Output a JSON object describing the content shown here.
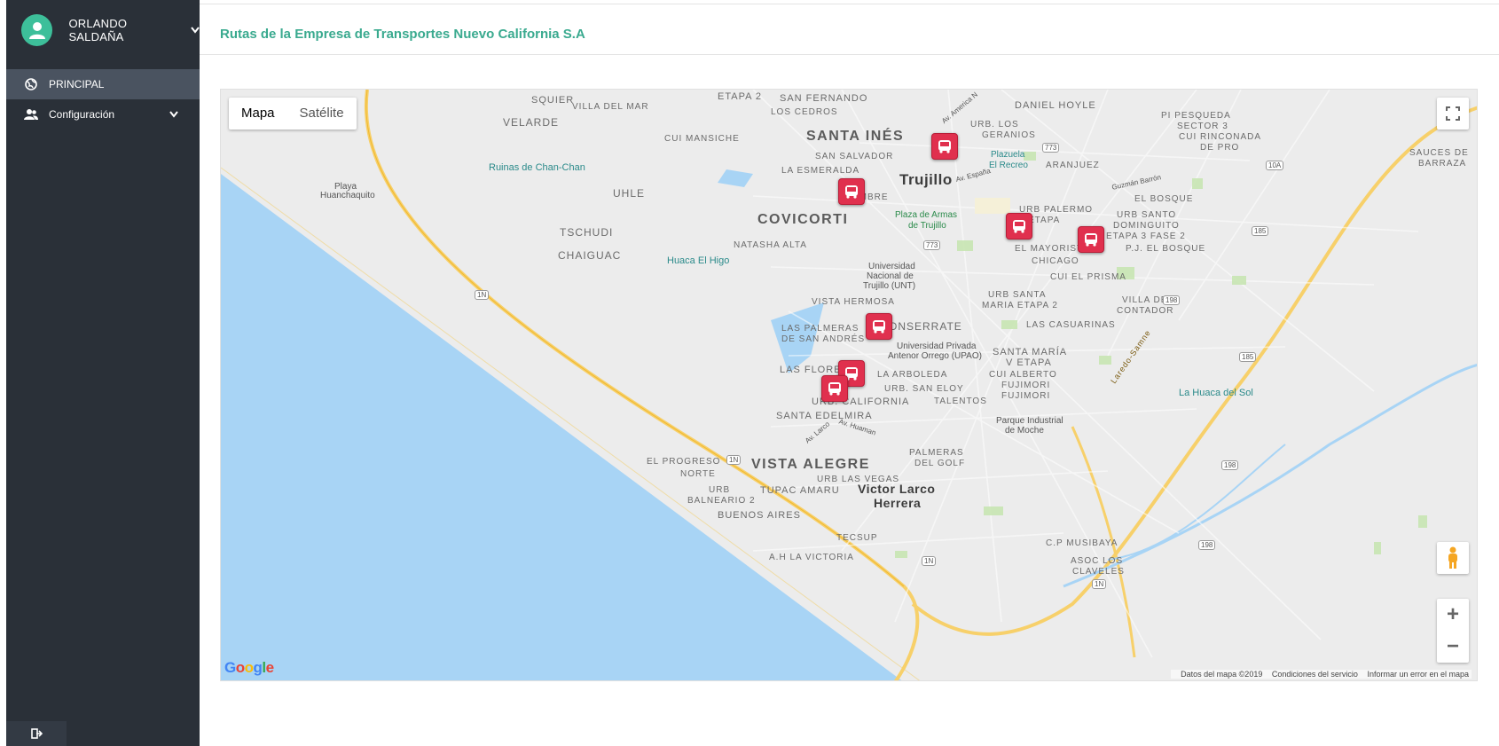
{
  "user": {
    "name": "ORLANDO SALDAÑA"
  },
  "sidebar": {
    "items": [
      {
        "label": "PRINCIPAL",
        "icon": "globe-icon",
        "active": true
      },
      {
        "label": "Configuración",
        "icon": "users-icon",
        "expandable": true
      }
    ]
  },
  "page": {
    "title": "Rutas de la Empresa de Transportes Nuevo California S.A"
  },
  "map": {
    "type_buttons": [
      "Mapa",
      "Satélite"
    ],
    "selected_type": "Mapa",
    "attribution": "Google",
    "footer": [
      "Datos del mapa ©2019",
      "Condiciones del servicio",
      "Informar un error en el mapa"
    ],
    "zoom_in": "+",
    "zoom_out": "−",
    "labels": {
      "squier": "SQUIER",
      "etapa2": "ETAPA 2",
      "san_fernando": "SAN FERNANDO",
      "daniel_hoyle": "DANIEL HOYLE",
      "villa_del_mar": "VILLA DEL MAR",
      "los_cedros": "LOS CEDROS",
      "velarde": "VELARDE",
      "pi_pesqueda": "PI PESQUEDA",
      "sector3": "SECTOR 3",
      "urb_los": "URB. LOS",
      "geranios": "GERANIOS",
      "santa_ines": "SANTA INÉS",
      "cui_mansiche": "CUI MANSICHE",
      "cui_rinconada": "CUI RINCONADA",
      "de_pro": "DE PRO",
      "sauces": "SAUCES DE",
      "barraza": "BARRAZA",
      "plazuela": "Plazuela",
      "el_recreo": "El Recreo",
      "aranjuez": "ARANJUEZ",
      "san_salvador": "SAN SALVADOR",
      "ruinas": "Ruinas de Chan-Chan",
      "la_esmeralda": "LA ESMERALDA",
      "trujillo": "Trujillo",
      "playa": "Playa",
      "huanchaquito": "Huanchaquito",
      "uhle": "UHLE",
      "ambre": "AMBRE",
      "el_bosque": "EL BOSQUE",
      "urb_palermo": "URB PALERMO",
      "etapa": "ETAPA",
      "urb_santo": "URB SANTO",
      "dominguito": "DOMINGUITO",
      "etapa3": "ETAPA 3 FASE 2",
      "covicorti": "COVICORTI",
      "plaza_armas": "Plaza de Armas",
      "de_trujillo": "de Trujillo",
      "tschudi": "TSCHUDI",
      "natasha": "NATASHA ALTA",
      "el_mayorista": "EL MAYORISTA",
      "pj_bosque": "P.J. EL BOSQUE",
      "chaiguac": "CHAIGUAC",
      "huaca_higo": "Huaca El Higo",
      "chicago": "CHICAGO",
      "universidad": "Universidad",
      "nacional": "Nacional de",
      "trujillo_unt": "Trujillo (UNT)",
      "cui_prisma": "CUI EL PRISMA",
      "vista_hermosa": "VISTA HERMOSA",
      "urb_santa": "URB SANTA",
      "maria_etapa2": "MARIA ETAPA 2",
      "villa_contador": "VILLA DEL",
      "contador": "CONTADOR",
      "monserrate": "MONSERRATE",
      "las_palmeras": "LAS PALMERAS",
      "de_san_andres": "DE SAN ANDRÉS",
      "las_casuarinas": "LAS CASUARINAS",
      "univ_privada": "Universidad Privada",
      "antenor": "Antenor Orrego (UPAO)",
      "santa_maria": "SANTA MARÍA",
      "v_etapa": "V ETAPA",
      "las_flores": "LAS FLORES",
      "la_arboleda": "LA ARBOLEDA",
      "cui_alberto": "CUI ALBERTO",
      "fujimori1": "FUJIMORI",
      "fujimori2": "FUJIMORI",
      "urb_san_eloy": "URB. SAN ELOY",
      "la_huaca_sol": "La Huaca del Sol",
      "urb_california": "URB. CALIFORNIA",
      "talentos": "TALENTOS",
      "santa_edelmira": "SANTA EDELMIRA",
      "parque_ind": "Parque Industrial",
      "de_moche": "de Moche",
      "el_progreso": "EL PROGRESO",
      "norte": "NORTE",
      "vista_alegre": "VISTA ALEGRE",
      "palmeras_golf": "PALMERAS",
      "del_golf": "DEL GOLF",
      "urb_las_vegas": "URB LAS VEGAS",
      "urb": "URB",
      "tupac_amaru": "TUPAC AMARU",
      "victor_larco": "Victor Larco",
      "herrera": "Herrera",
      "balneario2": "BALNEARIO 2",
      "buenos_aires": "BUENOS AIRES",
      "tecsup": "TECSUP",
      "ah_victoria": "A.H LA VICTORIA",
      "cp_musibaya": "C.P MUSIBAYA",
      "asoc_los": "ASOC LOS",
      "claveles": "CLAVELES",
      "laredo": "Laredo-Samne",
      "gzmn": "Guzmán Barrón",
      "av_espana": "Av. España",
      "av_larco": "Av. Larco",
      "av_huaman": "Av. Huaman",
      "av_america": "Av. America N"
    },
    "road_badges": [
      "1N",
      "1N",
      "773",
      "773",
      "10A",
      "185",
      "198",
      "185",
      "198",
      "198",
      "1N",
      "1N"
    ],
    "markers": [
      "bus-marker-1",
      "bus-marker-2",
      "bus-marker-3",
      "bus-marker-4",
      "bus-marker-5",
      "bus-marker-6",
      "bus-marker-7"
    ]
  }
}
